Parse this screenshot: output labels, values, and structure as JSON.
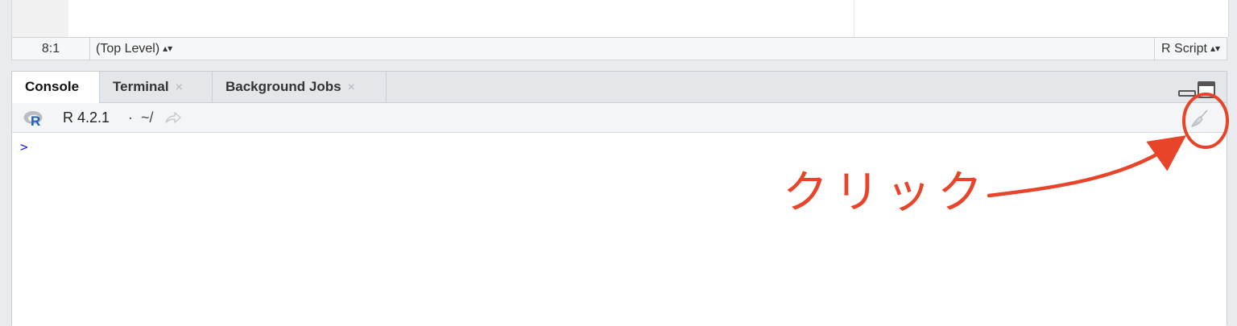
{
  "editor_status": {
    "cursor_position": "8:1",
    "scope": "(Top Level)",
    "file_type": "R Script"
  },
  "console_pane": {
    "tabs": [
      {
        "label": "Console",
        "active": true,
        "closable": false
      },
      {
        "label": "Terminal",
        "active": false,
        "closable": true
      },
      {
        "label": "Background Jobs",
        "active": false,
        "closable": true
      }
    ],
    "close_glyph": "×",
    "r_version": "R 4.2.1",
    "separator": "·",
    "working_dir": "~/",
    "prompt": ">",
    "icons": [
      "r-logo-icon",
      "go-to-directory-icon",
      "clear-console-broom-icon",
      "minimize-pane-icon",
      "maximize-pane-icon"
    ]
  },
  "annotation": {
    "label": "クリック",
    "color": "#e8442a"
  },
  "colors": {
    "accent_red": "#e8442a",
    "r_logo_blue": "#1e62b0",
    "prompt_blue": "#1a1aff"
  }
}
